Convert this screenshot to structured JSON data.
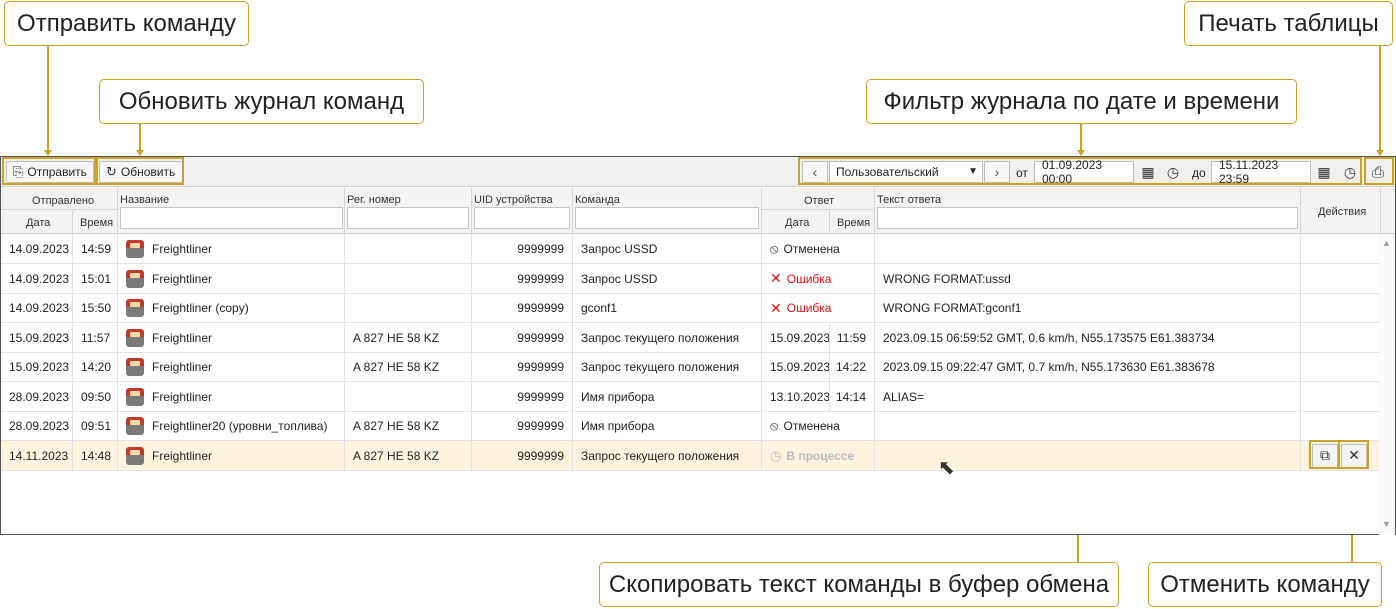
{
  "callouts": {
    "send": "Отправить команду",
    "refresh": "Обновить журнал команд",
    "filter": "Фильтр журнала по дате и времени",
    "print": "Печать таблицы",
    "copy": "Скопировать текст команды в буфер обмена",
    "cancel": "Отменить команду"
  },
  "toolbar": {
    "send_label": "Отправить",
    "refresh_label": "Обновить",
    "period_value": "Пользовательский",
    "from_label": "от",
    "from_value": "01.09.2023 00:00",
    "to_label": "до",
    "to_value": "15.11.2023 23:59"
  },
  "columns": {
    "sent": "Отправлено",
    "date": "Дата",
    "time": "Время",
    "name": "Название",
    "reg": "Рег. номер",
    "uid": "UID устройства",
    "command": "Команда",
    "answer": "Ответ",
    "answer_date": "Дата",
    "answer_time": "Время",
    "answer_text": "Текст ответа",
    "actions": "Действия"
  },
  "rows": [
    {
      "date": "14.09.2023",
      "time": "14:59",
      "name": "Freightliner",
      "reg": "",
      "uid": "9999999",
      "command": "Запрос USSD",
      "status": "cancel",
      "status_text": "Отменена",
      "adate": "",
      "atime": "",
      "text": ""
    },
    {
      "date": "14.09.2023",
      "time": "15:01",
      "name": "Freightliner",
      "reg": "",
      "uid": "9999999",
      "command": "Запрос USSD",
      "status": "error",
      "status_text": "Ошибка",
      "adate": "",
      "atime": "",
      "text": "WRONG FORMAT:ussd"
    },
    {
      "date": "14.09.2023",
      "time": "15:50",
      "name": "Freightliner (copy)",
      "reg": "",
      "uid": "9999999",
      "command": "gconf1",
      "status": "error",
      "status_text": "Ошибка",
      "adate": "",
      "atime": "",
      "text": "WRONG FORMAT:gconf1"
    },
    {
      "date": "15.09.2023",
      "time": "11:57",
      "name": "Freightliner",
      "reg": "A 827 HE 58 KZ",
      "uid": "9999999",
      "command": "Запрос текущего положения",
      "status": "ok",
      "status_text": "",
      "adate": "15.09.2023",
      "atime": "11:59",
      "text": "2023.09.15 06:59:52 GMT, 0.6 km/h, N55.173575 E61.383734"
    },
    {
      "date": "15.09.2023",
      "time": "14:20",
      "name": "Freightliner",
      "reg": "A 827 HE 58 KZ",
      "uid": "9999999",
      "command": "Запрос текущего положения",
      "status": "ok",
      "status_text": "",
      "adate": "15.09.2023",
      "atime": "14:22",
      "text": "2023.09.15 09:22:47 GMT, 0.7 km/h, N55.173630 E61.383678"
    },
    {
      "date": "28.09.2023",
      "time": "09:50",
      "name": "Freightliner",
      "reg": "",
      "uid": "9999999",
      "command": "Имя прибора",
      "status": "ok",
      "status_text": "",
      "adate": "13.10.2023",
      "atime": "14:14",
      "text": "ALIAS="
    },
    {
      "date": "28.09.2023",
      "time": "09:51",
      "name": "Freightliner20 (уровни_топлива)",
      "reg": "A 827 HE 58 KZ",
      "uid": "9999999",
      "command": "Имя прибора",
      "status": "cancel",
      "status_text": "Отменена",
      "adate": "",
      "atime": "",
      "text": ""
    },
    {
      "date": "14.11.2023",
      "time": "14:48",
      "name": "Freightliner",
      "reg": "A 827 HE 58 KZ",
      "uid": "9999999",
      "command": "Запрос текущего положения",
      "status": "proc",
      "status_text": "В процессе",
      "adate": "",
      "atime": "",
      "text": ""
    }
  ],
  "icons": {
    "send": "send-icon",
    "refresh": "refresh-icon",
    "calendar": "calendar-icon",
    "clock": "clock-icon",
    "print": "printer-icon",
    "copy": "copy-icon",
    "cancel": "close-icon",
    "vehicle": "truck-icon"
  },
  "colors": {
    "accent": "#c9a227",
    "error": "#dd1111",
    "active_row": "#fdf3df"
  }
}
